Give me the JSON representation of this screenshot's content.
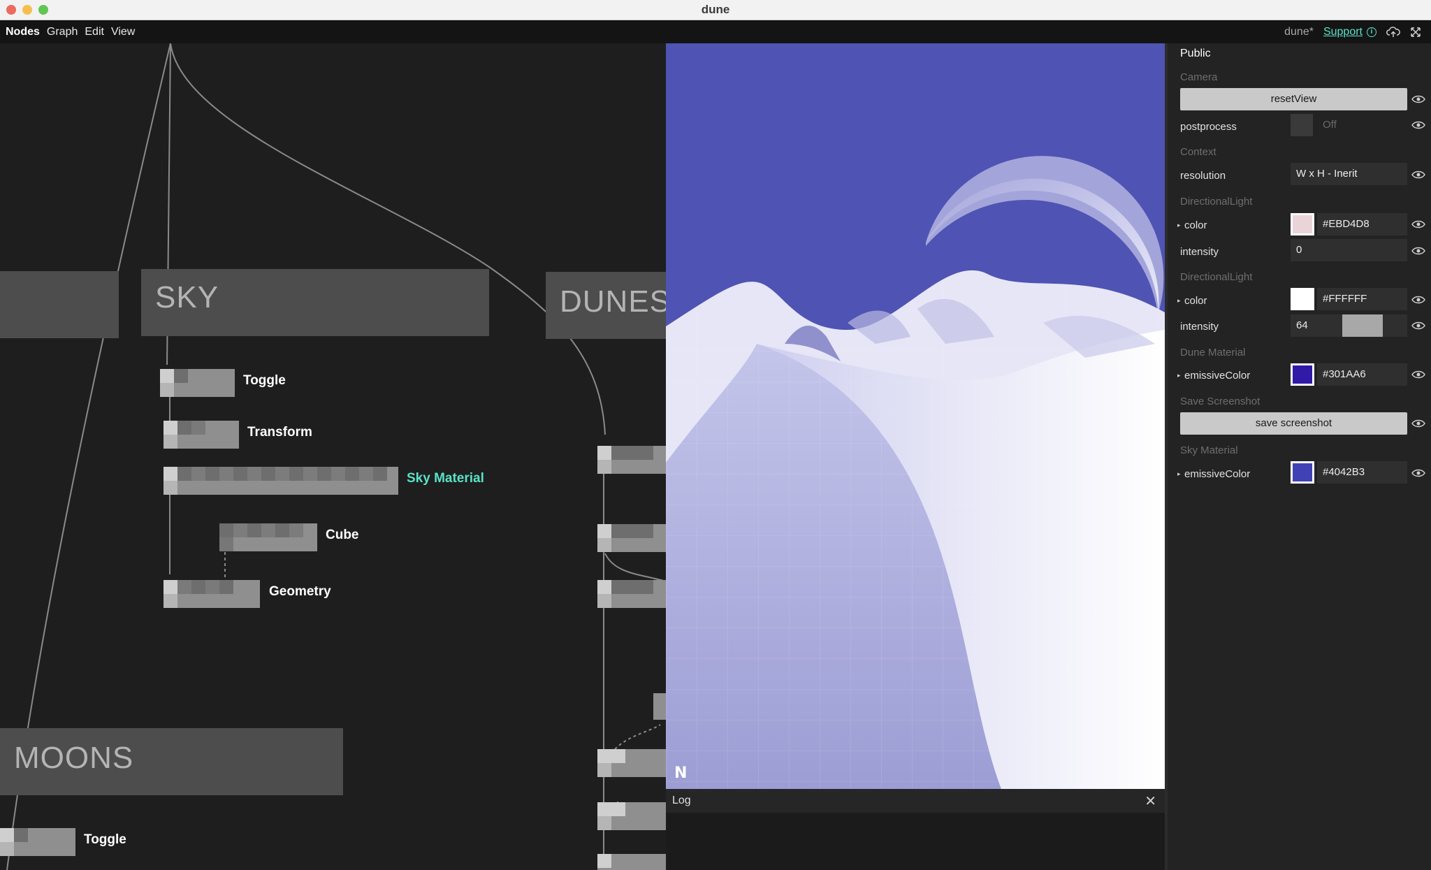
{
  "window": {
    "title": "dune"
  },
  "menubar": {
    "items": [
      "Nodes",
      "Graph",
      "Edit",
      "View"
    ],
    "doc_name": "dune*",
    "support_label": "Support"
  },
  "graph": {
    "groups": {
      "sky": "SKY",
      "dunes": "DUNES",
      "moons": "MOONS"
    },
    "nodes": {
      "toggle": "Toggle",
      "transform": "Transform",
      "sky_material": "Sky Material",
      "cube": "Cube",
      "geometry": "Geometry",
      "moons_toggle": "Toggle"
    }
  },
  "viewport": {
    "logo": "N"
  },
  "log": {
    "title": "Log"
  },
  "panel": {
    "title": "Public",
    "camera": {
      "section": "Camera",
      "reset_label": "resetView",
      "postprocess_label": "postprocess",
      "postprocess_value": "Off"
    },
    "context": {
      "section": "Context",
      "resolution_label": "resolution",
      "resolution_value": "W x H - Inerit"
    },
    "light1": {
      "section": "DirectionalLight",
      "color_label": "color",
      "color_value": "#EBD4D8",
      "intensity_label": "intensity",
      "intensity_value": "0"
    },
    "light2": {
      "section": "DirectionalLight",
      "color_label": "color",
      "color_value": "#FFFFFF",
      "intensity_label": "intensity",
      "intensity_value": "64",
      "intensity_fraction": 0.64
    },
    "dune_material": {
      "section": "Dune Material",
      "label": "emissiveColor",
      "value": "#301AA6"
    },
    "screenshot": {
      "section": "Save Screenshot",
      "button_label": "save screenshot"
    },
    "sky_material": {
      "section": "Sky Material",
      "label": "emissiveColor",
      "value": "#4042B3"
    }
  },
  "colors": {
    "accent": "#59E2C7",
    "sky": "#4F53B3"
  }
}
